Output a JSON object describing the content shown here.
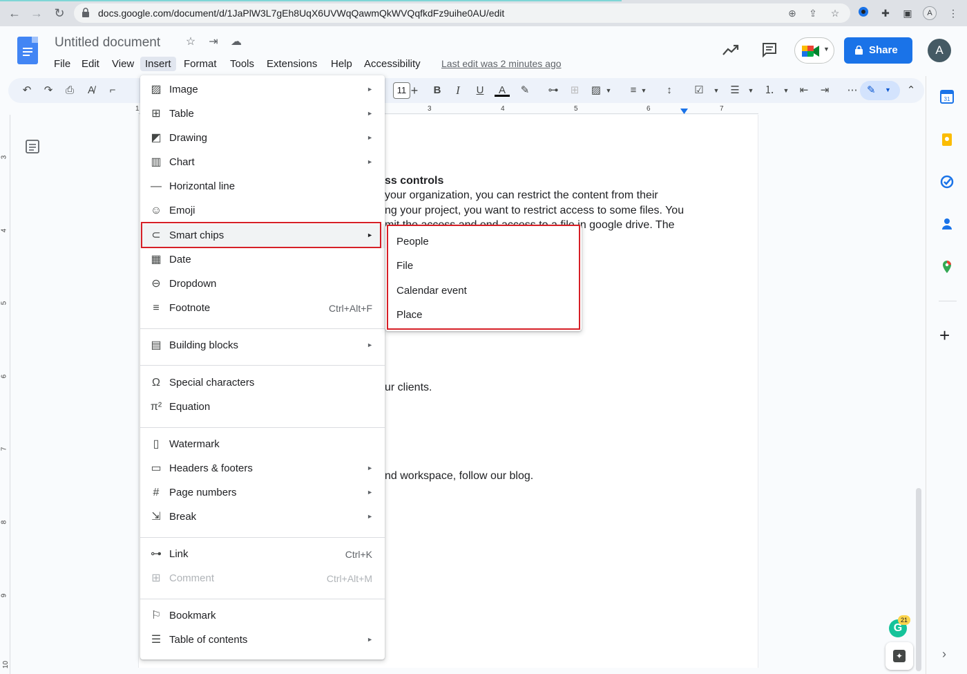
{
  "browser": {
    "url": "docs.google.com/document/d/1JaPlW3L7gEh8UqX6UVWqQawmQkWVQqfkdFz9uihe0AU/edit",
    "profile_letter": "A"
  },
  "header": {
    "title": "Untitled document",
    "menus": [
      "File",
      "Edit",
      "View",
      "Insert",
      "Format",
      "Tools",
      "Extensions",
      "Help",
      "Accessibility"
    ],
    "last_edit": "Last edit was 2 minutes ago",
    "share_label": "Share",
    "avatar_letter": "A"
  },
  "toolbar": {
    "font_size": "11"
  },
  "ruler": {
    "numbers": [
      "1",
      "3",
      "4",
      "5",
      "6",
      "7"
    ],
    "vertical_numbers": [
      "3",
      "4",
      "5",
      "6",
      "7",
      "8",
      "9",
      "10"
    ]
  },
  "page": {
    "heading_fragment": "ss controls",
    "line1": "your organization, you can restrict the content from their",
    "line2": "ng your project, you want to restrict access to some files. You",
    "line3": "mit the access and end access to a file in google drive. The",
    "line4": "ur clients.",
    "line5": "nd workspace, follow our blog."
  },
  "insert_menu": {
    "items": [
      {
        "label": "Image",
        "icon": "image-icon",
        "submenu": true
      },
      {
        "label": "Table",
        "icon": "table-icon",
        "submenu": true
      },
      {
        "label": "Drawing",
        "icon": "drawing-icon",
        "submenu": true
      },
      {
        "label": "Chart",
        "icon": "chart-icon",
        "submenu": true
      },
      {
        "label": "Horizontal line",
        "icon": "horizontal-line-icon"
      },
      {
        "label": "Emoji",
        "icon": "emoji-icon"
      },
      {
        "label": "Smart chips",
        "icon": "smart-chips-icon",
        "submenu": true
      },
      {
        "label": "Date",
        "icon": "calendar-icon"
      },
      {
        "label": "Dropdown",
        "icon": "dropdown-icon"
      },
      {
        "label": "Footnote",
        "icon": "footnote-icon",
        "shortcut": "Ctrl+Alt+F"
      },
      {
        "label": "Building blocks",
        "icon": "building-blocks-icon",
        "submenu": true
      },
      {
        "label": "Special characters",
        "icon": "omega-icon"
      },
      {
        "label": "Equation",
        "icon": "pi-icon"
      },
      {
        "label": "Watermark",
        "icon": "watermark-icon"
      },
      {
        "label": "Headers & footers",
        "icon": "headers-footers-icon",
        "submenu": true
      },
      {
        "label": "Page numbers",
        "icon": "hash-icon",
        "submenu": true
      },
      {
        "label": "Break",
        "icon": "break-icon",
        "submenu": true
      },
      {
        "label": "Link",
        "icon": "link-icon",
        "shortcut": "Ctrl+K"
      },
      {
        "label": "Comment",
        "icon": "comment-add-icon",
        "shortcut": "Ctrl+Alt+M",
        "disabled": true
      },
      {
        "label": "Bookmark",
        "icon": "bookmark-icon"
      },
      {
        "label": "Table of contents",
        "icon": "toc-icon",
        "submenu": true
      }
    ]
  },
  "smart_chips_submenu": {
    "items": [
      "People",
      "File",
      "Calendar event",
      "Place"
    ]
  },
  "grammarly": {
    "count": "21"
  },
  "colors": {
    "accent": "#1a73e8",
    "highlight_box": "#d61f26"
  }
}
